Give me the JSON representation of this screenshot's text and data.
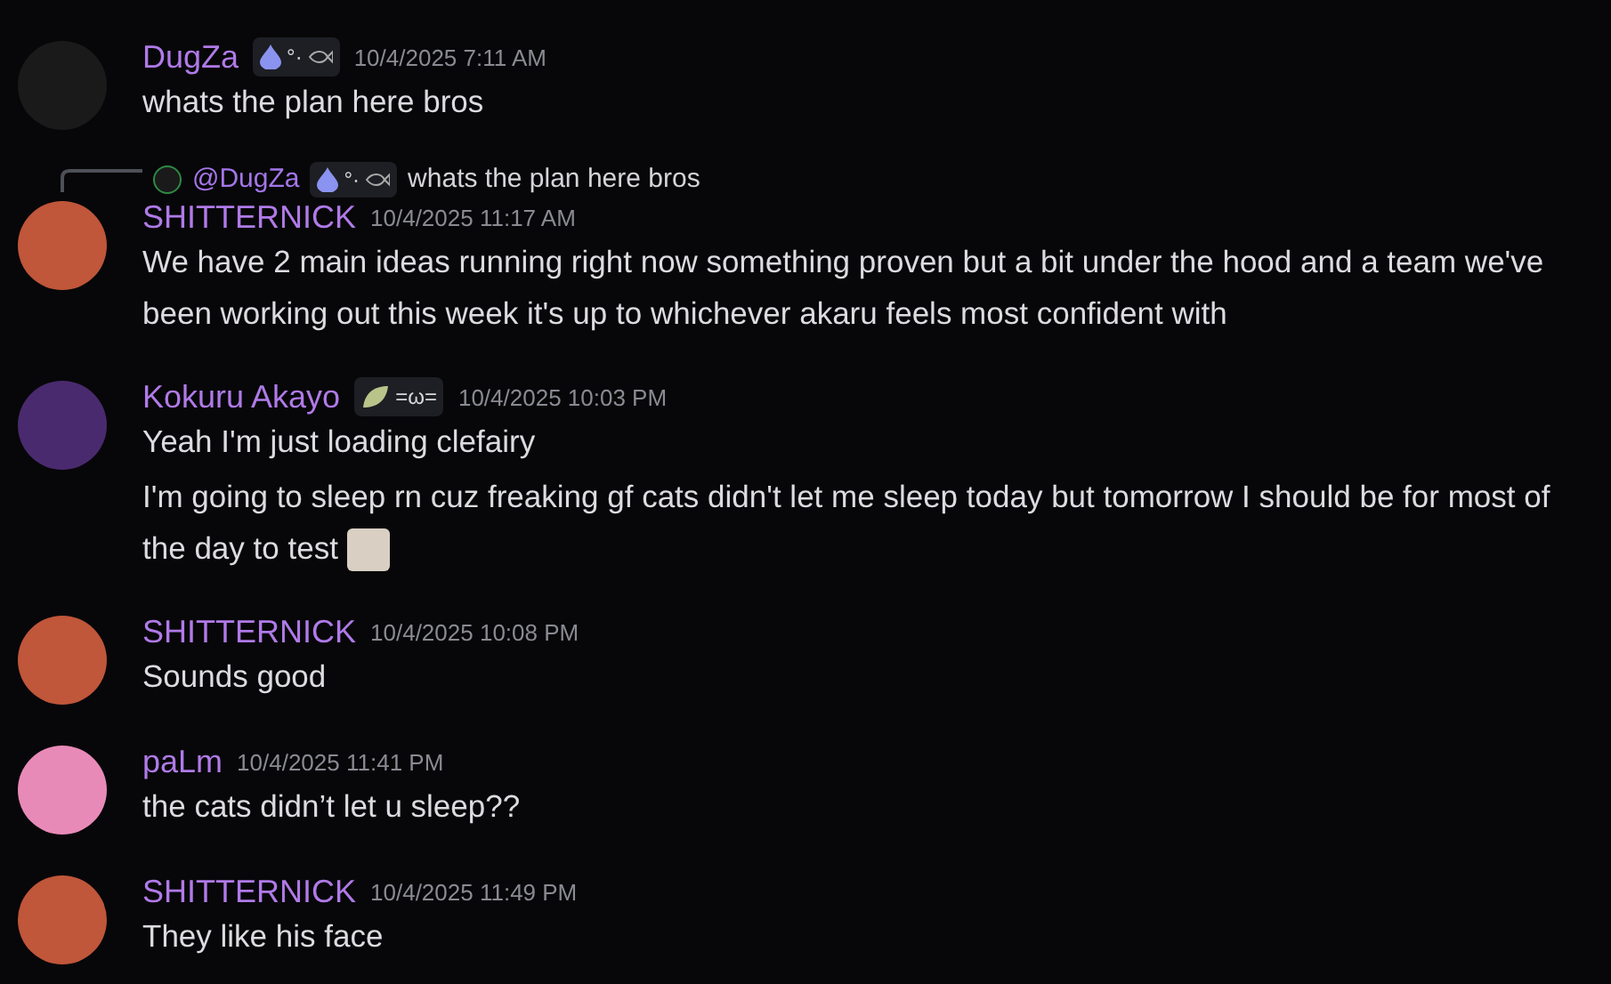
{
  "messages": [
    {
      "author": "DugZa",
      "color": "#1a1a1a",
      "tag": {
        "kind": "drop",
        "text": "°·",
        "fish": true
      },
      "time": "10/4/2025 7:11 AM",
      "lines": [
        {
          "text": "whats the plan here bros",
          "emoji": false
        }
      ]
    },
    {
      "reply": {
        "mention": "@DugZa",
        "tag": {
          "kind": "drop",
          "text": "°·",
          "fish": true
        },
        "text": "whats the plan here bros"
      },
      "author": "SHITTERNICK",
      "color": "#c0563a",
      "time": "10/4/2025 11:17 AM",
      "lines": [
        {
          "text": "We have 2 main ideas running right now something proven but a bit under the hood and a team we've been working out this week it's up to whichever akaru feels most confident with",
          "emoji": false
        }
      ]
    },
    {
      "author": "Kokuru Akayo",
      "color": "#4a2a6e",
      "tag": {
        "kind": "leaf",
        "text": "=ω=",
        "fish": false
      },
      "time": "10/4/2025 10:03 PM",
      "lines": [
        {
          "text": "Yeah I'm just loading clefairy",
          "emoji": false
        },
        {
          "text": "I'm going to sleep rn cuz freaking gf cats didn't let me sleep today but tomorrow I should be for most of the day to test",
          "emoji": true
        }
      ]
    },
    {
      "author": "SHITTERNICK",
      "color": "#c0563a",
      "time": "10/4/2025 10:08 PM",
      "lines": [
        {
          "text": "Sounds good",
          "emoji": false
        }
      ]
    },
    {
      "author": "paLm",
      "color": "#e88ab8",
      "time": "10/4/2025 11:41 PM",
      "lines": [
        {
          "text": "the cats didn’t let u sleep??",
          "emoji": false
        }
      ]
    },
    {
      "author": "SHITTERNICK",
      "color": "#c0563a",
      "time": "10/4/2025 11:49 PM",
      "lines": [
        {
          "text": "They like his face",
          "emoji": false
        }
      ]
    }
  ]
}
